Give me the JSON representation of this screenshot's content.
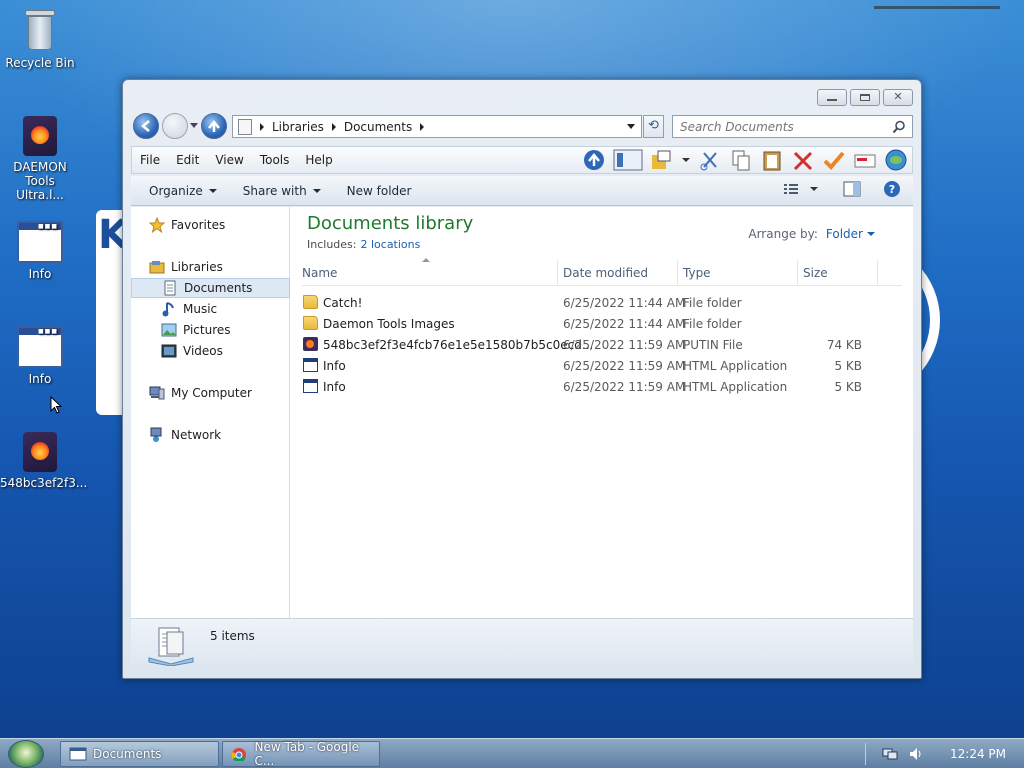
{
  "desktop": {
    "icons": [
      {
        "label": "Recycle Bin"
      },
      {
        "label": "DAEMON Tools Ultra.l..."
      },
      {
        "label": "Info"
      },
      {
        "label": "Info"
      },
      {
        "label": "548bc3ef2f3..."
      }
    ]
  },
  "window": {
    "breadcrumb": [
      "Libraries",
      "Documents"
    ],
    "search_placeholder": "Search Documents",
    "menu": [
      "File",
      "Edit",
      "View",
      "Tools",
      "Help"
    ],
    "commands": {
      "organize": "Organize",
      "share_with": "Share with",
      "new_folder": "New folder"
    },
    "nav": {
      "favorites": "Favorites",
      "libraries": "Libraries",
      "documents": "Documents",
      "music": "Music",
      "pictures": "Pictures",
      "videos": "Videos",
      "my_computer": "My Computer",
      "network": "Network"
    },
    "library": {
      "title": "Documents library",
      "includes_label": "Includes:",
      "includes_link": "2 locations",
      "arrange_label": "Arrange by:",
      "arrange_value": "Folder"
    },
    "columns": {
      "name": "Name",
      "date": "Date modified",
      "type": "Type",
      "size": "Size"
    },
    "files": [
      {
        "name": "Catch!",
        "date": "6/25/2022 11:44 AM",
        "type": "File folder",
        "size": "",
        "icon": "folder-icon"
      },
      {
        "name": "Daemon Tools Images",
        "date": "6/25/2022 11:44 AM",
        "type": "File folder",
        "size": "",
        "icon": "folder-icon"
      },
      {
        "name": "548bc3ef2f3e4fcb76e1e5e1580b7b5c0ecd...",
        "date": "6/25/2022 11:59 AM",
        "type": "PUTIN File",
        "size": "74 KB",
        "icon": "app-file-icon"
      },
      {
        "name": "Info",
        "date": "6/25/2022 11:59 AM",
        "type": "HTML Application",
        "size": "5 KB",
        "icon": "html-app-icon"
      },
      {
        "name": "Info",
        "date": "6/25/2022 11:59 AM",
        "type": "HTML Application",
        "size": "5 KB",
        "icon": "html-app-icon"
      }
    ],
    "status": {
      "count": "5 items"
    }
  },
  "taskbar": {
    "tasks": [
      {
        "label": "Documents"
      },
      {
        "label": "New Tab - Google C..."
      }
    ],
    "clock": "12:24 PM"
  }
}
